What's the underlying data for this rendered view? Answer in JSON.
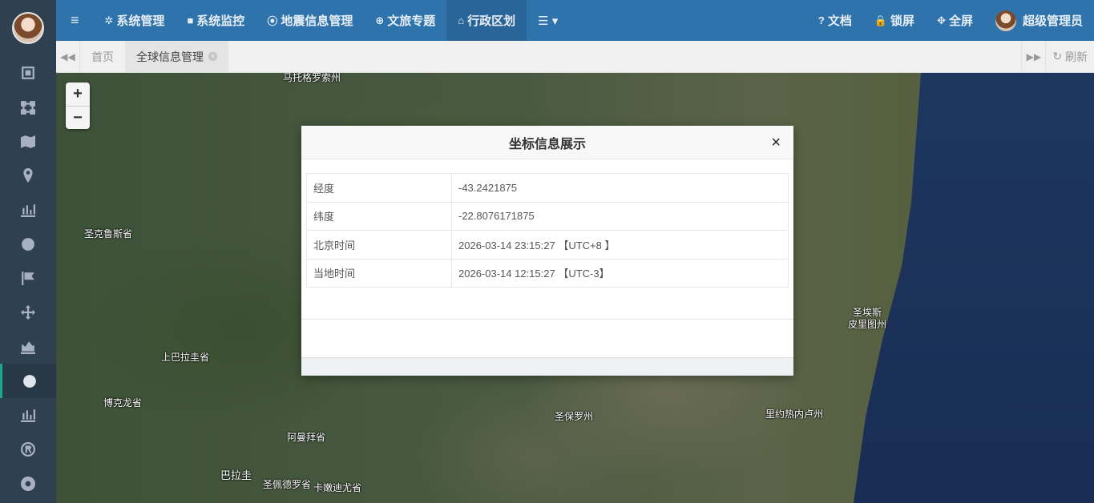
{
  "nav": {
    "menu_label": "≡",
    "items": [
      {
        "icon": "gear-icon",
        "glyph": "✲",
        "label": "系统管理"
      },
      {
        "icon": "video-icon",
        "glyph": "■",
        "label": "系统监控"
      },
      {
        "icon": "map-marker-icon",
        "glyph": "⦿",
        "label": "地震信息管理"
      },
      {
        "icon": "globe-icon",
        "glyph": "⊕",
        "label": "文旅专题"
      },
      {
        "icon": "bank-icon",
        "glyph": "⌂",
        "label": "行政区划"
      }
    ],
    "more_label": "☰ ▾",
    "right": {
      "docs": "文档",
      "docs_glyph": "?",
      "lock": "锁屏",
      "lock_glyph": "🔒",
      "fullscreen": "全屏",
      "fullscreen_glyph": "✥",
      "user": "超级管理员"
    }
  },
  "tabs": {
    "back_glyph": "◀◀",
    "forward_glyph": "▶▶",
    "items": [
      {
        "label": "首页"
      },
      {
        "label": "全球信息管理",
        "closable": true
      }
    ],
    "refresh": "刷新",
    "refresh_glyph": "↻"
  },
  "map": {
    "zoom_in": "+",
    "zoom_out": "−",
    "labels": [
      "马托格罗索州",
      "圣克鲁斯省",
      "上巴拉圭省",
      "博克龙省",
      "阿曼拜省",
      "巴拉圭",
      "圣佩德罗省",
      "卡嫩迪尤省",
      "圣保罗州",
      "里约热内卢州",
      "圣埃斯",
      "皮里图州"
    ]
  },
  "modal": {
    "title": "坐标信息展示",
    "close": "×",
    "rows": [
      {
        "key": "经度",
        "value": "-43.2421875"
      },
      {
        "key": "纬度",
        "value": "-22.8076171875"
      },
      {
        "key": "北京时间",
        "value": "2026-03-14 23:15:27 【UTC+8 】"
      },
      {
        "key": "当地时间",
        "value": "2026-03-14 12:15:27 【UTC-3】"
      }
    ]
  }
}
